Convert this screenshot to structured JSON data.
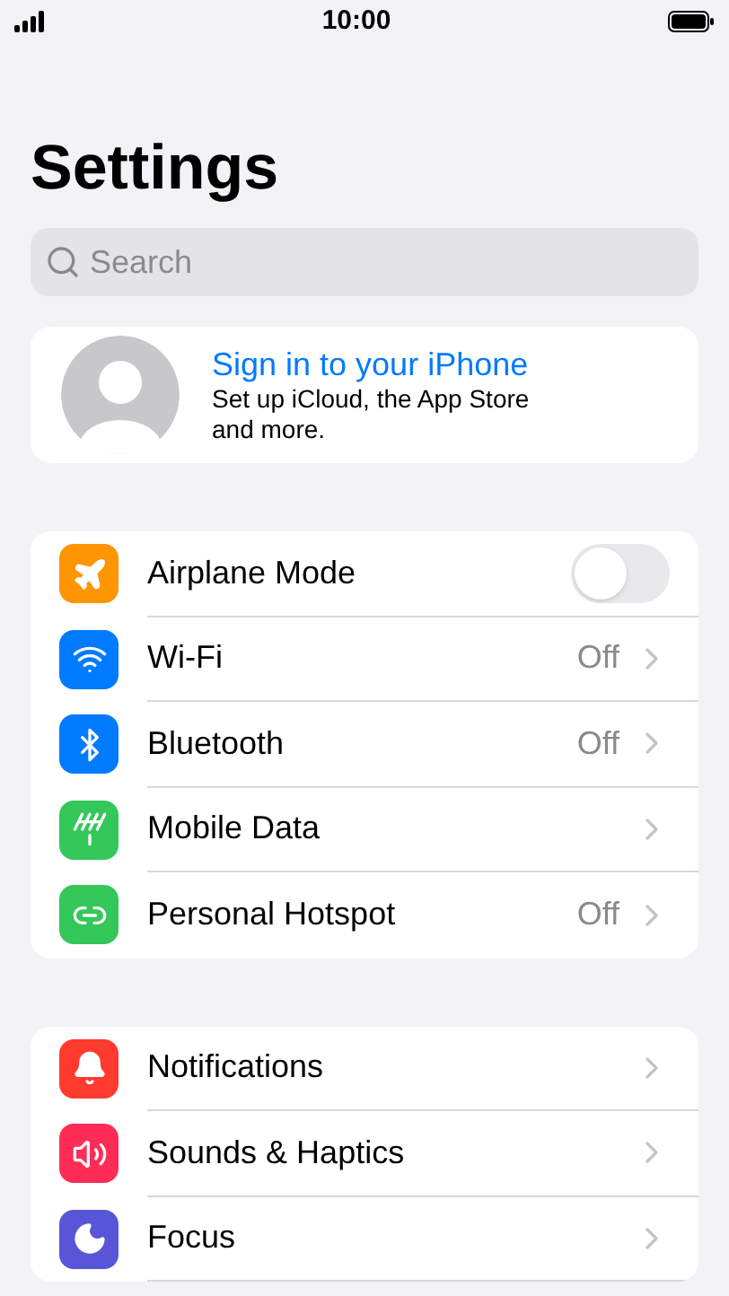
{
  "status_bar": {
    "time": "10:00"
  },
  "title": "Settings",
  "search": {
    "placeholder": "Search"
  },
  "account": {
    "title": "Sign in to your iPhone",
    "subtitle": "Set up iCloud, the App Store and more."
  },
  "groups": [
    {
      "rows": [
        {
          "kind": "toggle",
          "label": "Airplane Mode",
          "color": "#ff9500",
          "on": false
        },
        {
          "kind": "link",
          "label": "Wi-Fi",
          "color": "#007aff",
          "value": "Off"
        },
        {
          "kind": "link",
          "label": "Bluetooth",
          "color": "#007aff",
          "value": "Off"
        },
        {
          "kind": "link",
          "label": "Mobile Data",
          "color": "#34c759"
        },
        {
          "kind": "link",
          "label": "Personal Hotspot",
          "color": "#34c759",
          "value": "Off"
        }
      ]
    },
    {
      "rows": [
        {
          "kind": "link",
          "label": "Notifications",
          "color": "#ff3b30"
        },
        {
          "kind": "link",
          "label": "Sounds & Haptics",
          "color": "#ff2d55"
        },
        {
          "kind": "link",
          "label": "Focus",
          "color": "#5856d6"
        }
      ]
    }
  ]
}
